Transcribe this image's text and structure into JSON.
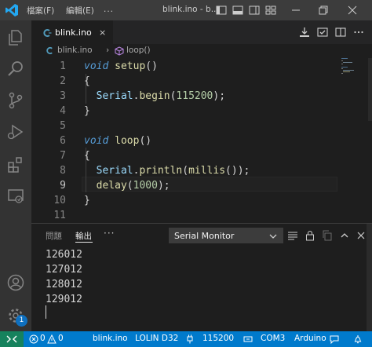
{
  "titlebar": {
    "menus": [
      "檔案(F)",
      "編輯(E)",
      "..."
    ],
    "window_title": "blink.ino - b..."
  },
  "activity_bar": {
    "items": [
      "explorer-icon",
      "search-icon",
      "source-control-icon",
      "run-debug-icon",
      "extensions-icon",
      "remote-explorer-icon",
      "account-icon",
      "manage-gear-icon"
    ],
    "manage_badge": "1"
  },
  "tabs": [
    {
      "label": "blink.ino",
      "close": "×"
    }
  ],
  "breadcrumb": {
    "file": "blink.ino",
    "separator": "›",
    "symbol": "loop()"
  },
  "editor": {
    "current_line": 9,
    "lines": [
      {
        "n": "1"
      },
      {
        "n": "2"
      },
      {
        "n": "3"
      },
      {
        "n": "4"
      },
      {
        "n": "5"
      },
      {
        "n": "6"
      },
      {
        "n": "7"
      },
      {
        "n": "8"
      },
      {
        "n": "9"
      },
      {
        "n": "10"
      },
      {
        "n": "11"
      }
    ],
    "tokens": {
      "void": "void",
      "setup": "setup",
      "loop": "loop",
      "parens": "()",
      "open_brace": "{",
      "close_brace": "}",
      "serial": "Serial",
      "dot": ".",
      "begin": "begin",
      "baud": "115200",
      "println": "println",
      "millis": "millis",
      "delay": "delay",
      "delay_ms": "1000",
      "lp": "(",
      "rp": ")",
      "end_stmt": ");",
      "end_stmt2": "));"
    }
  },
  "panel": {
    "tabs": [
      {
        "label": "問題",
        "active": false
      },
      {
        "label": "輸出",
        "active": true
      }
    ],
    "more": "···",
    "monitor_select": "Serial Monitor",
    "output_lines": [
      "126012",
      "127012",
      "128012",
      "129012"
    ]
  },
  "statusbar": {
    "errors": "0",
    "warnings": "0",
    "file": "blink.ino",
    "board": "LOLIN D32",
    "baud": "115200",
    "port": "COM3",
    "platform": "Arduino"
  },
  "colors": {
    "accent": "#007acc",
    "keyword": "#569cd6",
    "function": "#dcdcaa",
    "number": "#b5cea8",
    "variable": "#9cdcfe"
  }
}
